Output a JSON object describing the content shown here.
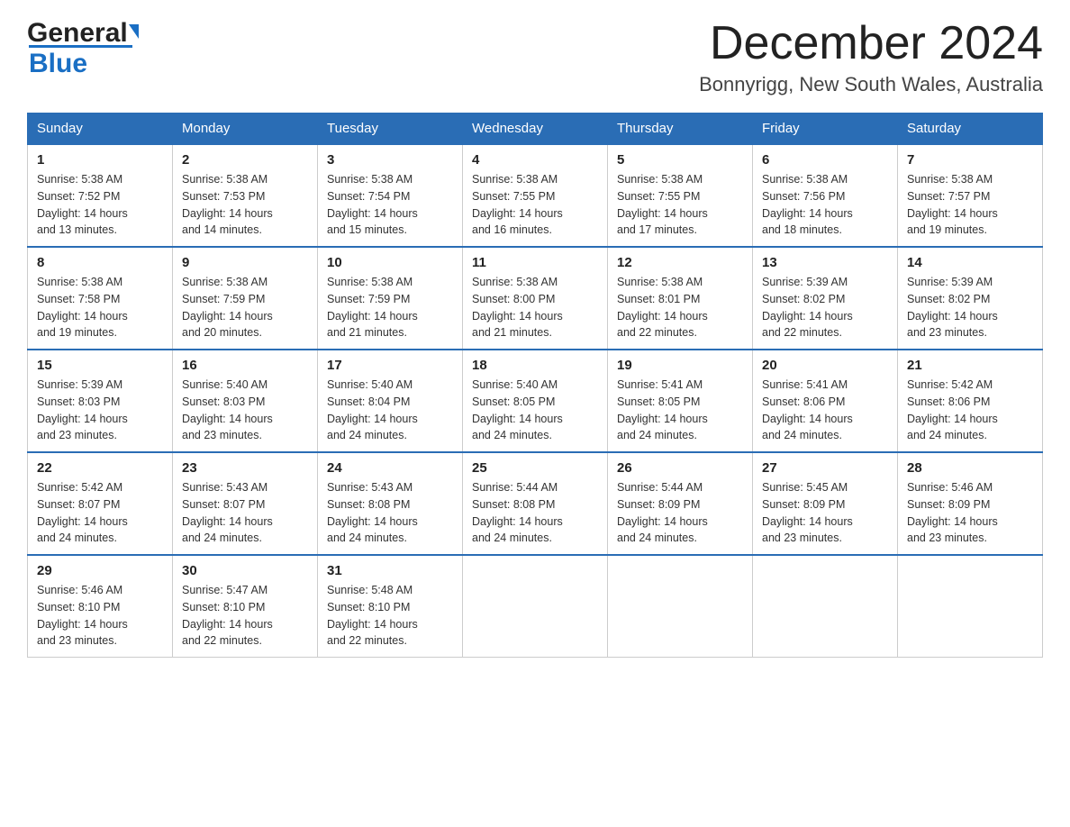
{
  "logo": {
    "name_black": "General",
    "name_blue": "Blue"
  },
  "title": "December 2024",
  "subtitle": "Bonnyrigg, New South Wales, Australia",
  "days_of_week": [
    "Sunday",
    "Monday",
    "Tuesday",
    "Wednesday",
    "Thursday",
    "Friday",
    "Saturday"
  ],
  "weeks": [
    [
      {
        "day": "1",
        "sunrise": "5:38 AM",
        "sunset": "7:52 PM",
        "daylight": "14 hours and 13 minutes."
      },
      {
        "day": "2",
        "sunrise": "5:38 AM",
        "sunset": "7:53 PM",
        "daylight": "14 hours and 14 minutes."
      },
      {
        "day": "3",
        "sunrise": "5:38 AM",
        "sunset": "7:54 PM",
        "daylight": "14 hours and 15 minutes."
      },
      {
        "day": "4",
        "sunrise": "5:38 AM",
        "sunset": "7:55 PM",
        "daylight": "14 hours and 16 minutes."
      },
      {
        "day": "5",
        "sunrise": "5:38 AM",
        "sunset": "7:55 PM",
        "daylight": "14 hours and 17 minutes."
      },
      {
        "day": "6",
        "sunrise": "5:38 AM",
        "sunset": "7:56 PM",
        "daylight": "14 hours and 18 minutes."
      },
      {
        "day": "7",
        "sunrise": "5:38 AM",
        "sunset": "7:57 PM",
        "daylight": "14 hours and 19 minutes."
      }
    ],
    [
      {
        "day": "8",
        "sunrise": "5:38 AM",
        "sunset": "7:58 PM",
        "daylight": "14 hours and 19 minutes."
      },
      {
        "day": "9",
        "sunrise": "5:38 AM",
        "sunset": "7:59 PM",
        "daylight": "14 hours and 20 minutes."
      },
      {
        "day": "10",
        "sunrise": "5:38 AM",
        "sunset": "7:59 PM",
        "daylight": "14 hours and 21 minutes."
      },
      {
        "day": "11",
        "sunrise": "5:38 AM",
        "sunset": "8:00 PM",
        "daylight": "14 hours and 21 minutes."
      },
      {
        "day": "12",
        "sunrise": "5:38 AM",
        "sunset": "8:01 PM",
        "daylight": "14 hours and 22 minutes."
      },
      {
        "day": "13",
        "sunrise": "5:39 AM",
        "sunset": "8:02 PM",
        "daylight": "14 hours and 22 minutes."
      },
      {
        "day": "14",
        "sunrise": "5:39 AM",
        "sunset": "8:02 PM",
        "daylight": "14 hours and 23 minutes."
      }
    ],
    [
      {
        "day": "15",
        "sunrise": "5:39 AM",
        "sunset": "8:03 PM",
        "daylight": "14 hours and 23 minutes."
      },
      {
        "day": "16",
        "sunrise": "5:40 AM",
        "sunset": "8:03 PM",
        "daylight": "14 hours and 23 minutes."
      },
      {
        "day": "17",
        "sunrise": "5:40 AM",
        "sunset": "8:04 PM",
        "daylight": "14 hours and 24 minutes."
      },
      {
        "day": "18",
        "sunrise": "5:40 AM",
        "sunset": "8:05 PM",
        "daylight": "14 hours and 24 minutes."
      },
      {
        "day": "19",
        "sunrise": "5:41 AM",
        "sunset": "8:05 PM",
        "daylight": "14 hours and 24 minutes."
      },
      {
        "day": "20",
        "sunrise": "5:41 AM",
        "sunset": "8:06 PM",
        "daylight": "14 hours and 24 minutes."
      },
      {
        "day": "21",
        "sunrise": "5:42 AM",
        "sunset": "8:06 PM",
        "daylight": "14 hours and 24 minutes."
      }
    ],
    [
      {
        "day": "22",
        "sunrise": "5:42 AM",
        "sunset": "8:07 PM",
        "daylight": "14 hours and 24 minutes."
      },
      {
        "day": "23",
        "sunrise": "5:43 AM",
        "sunset": "8:07 PM",
        "daylight": "14 hours and 24 minutes."
      },
      {
        "day": "24",
        "sunrise": "5:43 AM",
        "sunset": "8:08 PM",
        "daylight": "14 hours and 24 minutes."
      },
      {
        "day": "25",
        "sunrise": "5:44 AM",
        "sunset": "8:08 PM",
        "daylight": "14 hours and 24 minutes."
      },
      {
        "day": "26",
        "sunrise": "5:44 AM",
        "sunset": "8:09 PM",
        "daylight": "14 hours and 24 minutes."
      },
      {
        "day": "27",
        "sunrise": "5:45 AM",
        "sunset": "8:09 PM",
        "daylight": "14 hours and 23 minutes."
      },
      {
        "day": "28",
        "sunrise": "5:46 AM",
        "sunset": "8:09 PM",
        "daylight": "14 hours and 23 minutes."
      }
    ],
    [
      {
        "day": "29",
        "sunrise": "5:46 AM",
        "sunset": "8:10 PM",
        "daylight": "14 hours and 23 minutes."
      },
      {
        "day": "30",
        "sunrise": "5:47 AM",
        "sunset": "8:10 PM",
        "daylight": "14 hours and 22 minutes."
      },
      {
        "day": "31",
        "sunrise": "5:48 AM",
        "sunset": "8:10 PM",
        "daylight": "14 hours and 22 minutes."
      },
      null,
      null,
      null,
      null
    ]
  ],
  "labels": {
    "sunrise": "Sunrise:",
    "sunset": "Sunset:",
    "daylight": "Daylight:"
  }
}
